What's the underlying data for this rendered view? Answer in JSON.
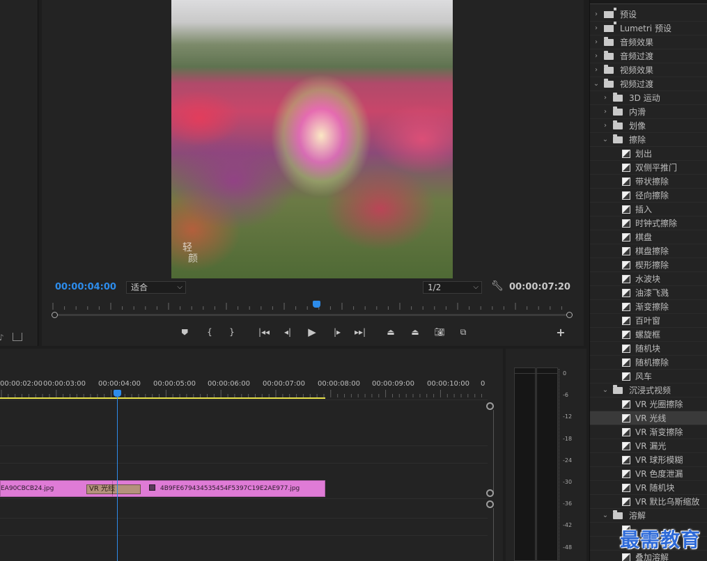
{
  "monitor": {
    "current_timecode": "00:00:04:00",
    "duration_timecode": "00:00:07:20",
    "zoom_value": "适合",
    "resolution_value": "1/2",
    "frame_watermark": [
      "轻",
      "颜"
    ]
  },
  "timeline": {
    "ruler_labels": [
      "00:00:02:00",
      "00:00:03:00",
      "00:00:04:00",
      "00:00:05:00",
      "00:00:06:00",
      "00:00:07:00",
      "00:00:08:00",
      "00:00:09:00",
      "00:00:10:00",
      "0"
    ],
    "clip_a": "EA90CBCB24.jpg",
    "clip_b": "4B9FE679434535454F5397C19E2AE977.jpg",
    "transition_label": "VR 光线"
  },
  "audio_meter": {
    "db_labels": [
      "0",
      "-6",
      "-12",
      "-18",
      "-24",
      "-30",
      "-36",
      "-42",
      "-48"
    ]
  },
  "effects": {
    "items": [
      {
        "label": "预设",
        "kind": "preset-folder",
        "level": 0,
        "expanded": false
      },
      {
        "label": "Lumetri 预设",
        "kind": "preset-folder",
        "level": 0,
        "expanded": false
      },
      {
        "label": "音频效果",
        "kind": "folder",
        "level": 0,
        "expanded": false
      },
      {
        "label": "音频过渡",
        "kind": "folder",
        "level": 0,
        "expanded": false
      },
      {
        "label": "视频效果",
        "kind": "folder",
        "level": 0,
        "expanded": false
      },
      {
        "label": "视频过渡",
        "kind": "folder",
        "level": 0,
        "expanded": true
      },
      {
        "label": "3D 运动",
        "kind": "folder",
        "level": 1,
        "expanded": false
      },
      {
        "label": "内滑",
        "kind": "folder",
        "level": 1,
        "expanded": false
      },
      {
        "label": "划像",
        "kind": "folder",
        "level": 1,
        "expanded": false
      },
      {
        "label": "擦除",
        "kind": "folder",
        "level": 1,
        "expanded": true
      },
      {
        "label": "划出",
        "kind": "transition",
        "level": 2
      },
      {
        "label": "双侧平推门",
        "kind": "transition",
        "level": 2
      },
      {
        "label": "带状擦除",
        "kind": "transition",
        "level": 2
      },
      {
        "label": "径向擦除",
        "kind": "transition",
        "level": 2
      },
      {
        "label": "插入",
        "kind": "transition",
        "level": 2
      },
      {
        "label": "时钟式擦除",
        "kind": "transition",
        "level": 2
      },
      {
        "label": "棋盘",
        "kind": "transition",
        "level": 2
      },
      {
        "label": "棋盘擦除",
        "kind": "transition",
        "level": 2
      },
      {
        "label": "楔形擦除",
        "kind": "transition",
        "level": 2
      },
      {
        "label": "水波块",
        "kind": "transition",
        "level": 2
      },
      {
        "label": "油漆飞溅",
        "kind": "transition",
        "level": 2
      },
      {
        "label": "渐变擦除",
        "kind": "transition",
        "level": 2
      },
      {
        "label": "百叶窗",
        "kind": "transition",
        "level": 2
      },
      {
        "label": "螺旋框",
        "kind": "transition",
        "level": 2
      },
      {
        "label": "随机块",
        "kind": "transition",
        "level": 2
      },
      {
        "label": "随机擦除",
        "kind": "transition",
        "level": 2
      },
      {
        "label": "风车",
        "kind": "transition",
        "level": 2
      },
      {
        "label": "沉浸式视频",
        "kind": "folder",
        "level": 1,
        "expanded": true
      },
      {
        "label": "VR 光圈擦除",
        "kind": "transition",
        "level": 2
      },
      {
        "label": "VR 光线",
        "kind": "transition",
        "level": 2,
        "selected": true
      },
      {
        "label": "VR 渐变擦除",
        "kind": "transition",
        "level": 2
      },
      {
        "label": "VR 漏光",
        "kind": "transition",
        "level": 2
      },
      {
        "label": "VR 球形模糊",
        "kind": "transition",
        "level": 2
      },
      {
        "label": "VR 色度泄漏",
        "kind": "transition",
        "level": 2
      },
      {
        "label": "VR 随机块",
        "kind": "transition",
        "level": 2
      },
      {
        "label": "VR 默比乌斯缩放",
        "kind": "transition",
        "level": 2
      },
      {
        "label": "溶解",
        "kind": "folder",
        "level": 1,
        "expanded": true
      },
      {
        "label": "",
        "kind": "transition",
        "level": 2
      },
      {
        "label": "",
        "kind": "transition",
        "level": 2
      },
      {
        "label": "叠加溶解",
        "kind": "transition",
        "level": 2
      }
    ]
  },
  "site_watermark": "最需教育",
  "colors": {
    "accent_blue": "#2d8ceb",
    "clip_pink": "#df7bd6",
    "work_area_yellow": "#e8e24a",
    "panel_bg": "#232323"
  }
}
